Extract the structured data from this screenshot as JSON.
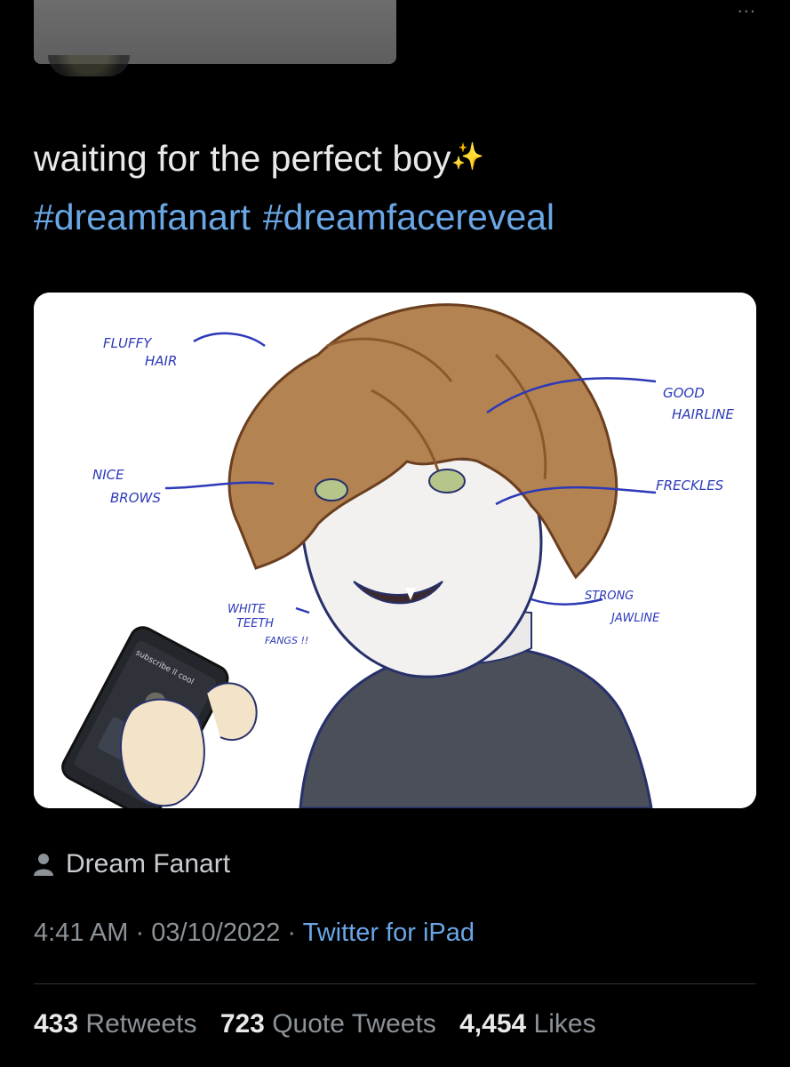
{
  "header": {
    "more_icon": "ellipsis-icon",
    "more_label": "..."
  },
  "tweet": {
    "text": "waiting for the perfect boy",
    "emoji": "✨",
    "hashtags": [
      "#dreamfanart",
      "#dreamfacereveal"
    ]
  },
  "media": {
    "annotations": {
      "fluffy_hair": [
        "FLUFFY",
        "HAIR"
      ],
      "good_hairline": [
        "GOOD",
        "HAIRLINE"
      ],
      "nice_brows": [
        "NICE",
        "BROWS"
      ],
      "freckles": "FRECKLES",
      "white_teeth": [
        "WHITE",
        "TEETH"
      ],
      "fangs": "FANGS !!",
      "strong_jawline": [
        "STRONG",
        "JAWLINE"
      ]
    },
    "phone_screen_text": "subscribe ll cool"
  },
  "author": {
    "icon": "person-icon",
    "name": "Dream Fanart"
  },
  "meta": {
    "time": "4:41 AM",
    "separator": " · ",
    "date": "03/10/2022",
    "source": "Twitter for iPad"
  },
  "stats": {
    "retweets_count": "433",
    "retweets_label": "Retweets",
    "quotes_count": "723",
    "quotes_label": "Quote Tweets",
    "likes_count": "4,454",
    "likes_label": "Likes"
  },
  "colors": {
    "background": "#000000",
    "link": "#6aa7e6",
    "text": "#e7e9ea",
    "muted": "#8b9298"
  }
}
